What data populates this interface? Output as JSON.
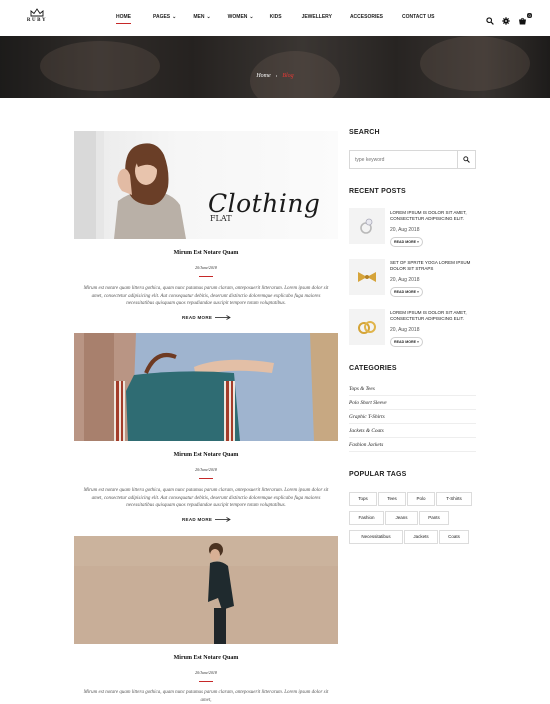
{
  "brand": {
    "name": "RUBY"
  },
  "nav": {
    "items": [
      {
        "label": "HOME",
        "has_dropdown": false
      },
      {
        "label": "PAGES",
        "has_dropdown": true
      },
      {
        "label": "MEN",
        "has_dropdown": true
      },
      {
        "label": "WOMEN",
        "has_dropdown": true
      },
      {
        "label": "KIDS",
        "has_dropdown": false
      },
      {
        "label": "JEWELLERY",
        "has_dropdown": false
      },
      {
        "label": "ACCESORIES",
        "has_dropdown": false
      },
      {
        "label": "CONTACT US",
        "has_dropdown": false
      }
    ],
    "active": "HOME",
    "icons": [
      "search-icon",
      "gear-icon",
      "cart-icon"
    ],
    "cart_count": "0"
  },
  "banner": {
    "title": "BLOG",
    "breadcrumb": {
      "home": "Home",
      "separator": "›",
      "current": "Blog"
    }
  },
  "posts": [
    {
      "image": "woman-clothing-photo",
      "image_text": "Clothing",
      "image_text_partial": "FLAT",
      "title": "Mirum Est Notare Quam",
      "date": "20/June/2018",
      "excerpt": "Mirum est notare quam littera gothica, quam nunc putamus parum claram, anteposuerit litterarum. Lorem ipsum dolor sit amet, consectetur adipisicing elit. Aut consequatur debitis, deserunt distinctio doloremque explicabo fuga maiores necessitatibus quisquam quos repudiandae suscipit tempore totam voluptatibus.",
      "read_more": "READ MORE"
    },
    {
      "image": "handbag-photo",
      "title": "Mirum Est Notare Quam",
      "date": "20/June/2018",
      "excerpt": "Mirum est notare quam littera gothica, quam nunc putamus parum claram, anteposuerit litterarum. Lorem ipsum dolor sit amet, consectetur adipisicing elit. Aut consequatur debitis, deserunt distinctio doloremque explicabo fuga maiores necessitatibus quisquam quos repudiandae suscipit tempore totam voluptatibus.",
      "read_more": "READ MORE"
    },
    {
      "image": "man-hoodie-photo",
      "title": "Mirum Est Notare Quam",
      "date": "20/June/2018",
      "excerpt": "Mirum est notare quam littera gothica, quam nunc putamus parum claram, anteposuerit litterarum. Lorem ipsum dolor sit amet,"
    }
  ],
  "sidebar": {
    "search": {
      "heading": "SEARCH",
      "placeholder": "type keyword"
    },
    "recent": {
      "heading": "RECENT POSTS",
      "items": [
        {
          "title": "LOREM IPSUM IS DOLOR SIT AMET, CONSECTETUR ADIPISICING ELIT.",
          "date": "20, Aug 2018",
          "more": "READ MORE »",
          "thumb": "ring-icon"
        },
        {
          "title": "SET OF SPRITE YOGA LOREM IPSUM DOLOR SIT STRAPS",
          "date": "20, Aug 2018",
          "more": "READ MORE »",
          "thumb": "bow-icon"
        },
        {
          "title": "LOREM IPSUM IS DOLOR SIT AMET, CONSECTETUR ADIPISICING ELIT.",
          "date": "20, Aug 2018",
          "more": "READ MORE »",
          "thumb": "rings-icon"
        }
      ]
    },
    "categories": {
      "heading": "CATEGORIES",
      "items": [
        "Tops & Tees",
        "Polo Short Sleeve",
        "Graphic T-Shirts",
        "Jackets & Coats",
        "Fashion Jackets"
      ]
    },
    "tags": {
      "heading": "POPULAR TAGS",
      "items": [
        "Tops",
        "Tees",
        "Polo",
        "T-Shirts",
        "Fashion",
        "Jeans",
        "Pants",
        "Necessitatibus",
        "Jackets",
        "Coats"
      ]
    }
  },
  "colors": {
    "accent": "#c62828",
    "text": "#222222",
    "muted": "#555555",
    "border": "#dcdcdc"
  }
}
